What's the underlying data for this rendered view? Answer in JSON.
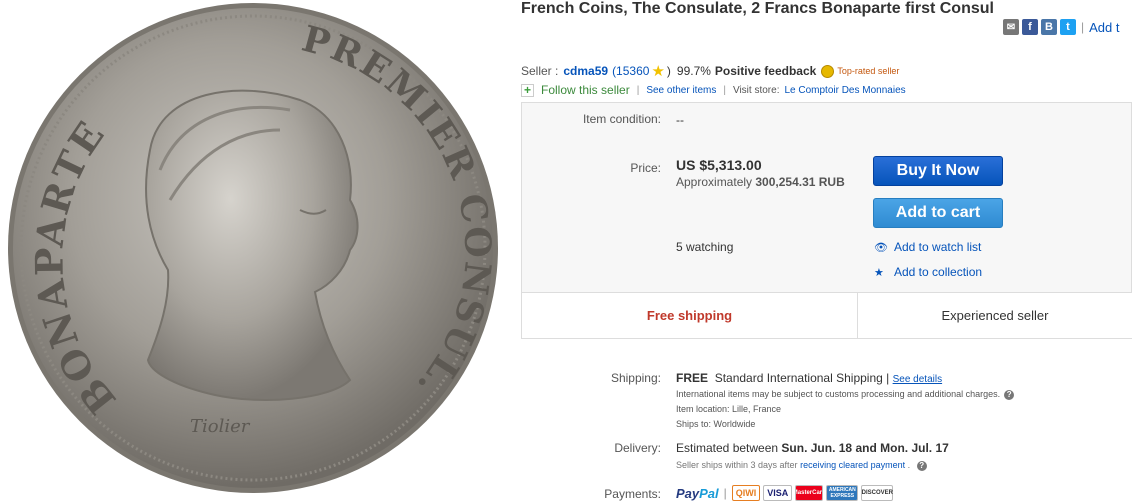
{
  "title": "French Coins, The Consulate, 2 Francs Bonaparte first Consul",
  "coin": {
    "left_text": "BONAPARTE",
    "right_text": "PREMIER CONSUL.",
    "signature": "Tiolier"
  },
  "share": {
    "icons": [
      "mail-icon",
      "facebook-icon",
      "vk-icon",
      "twitter-icon"
    ],
    "fb": "f",
    "vk": "B",
    "tw": "t",
    "separator": "|",
    "add_label": "Add t"
  },
  "seller": {
    "label": "Seller :",
    "name": "cdma59",
    "score_open": "(15360",
    "score_close": ")",
    "percent": "99.7%",
    "positive": "Positive feedback",
    "badge": "Top-rated seller",
    "follow": "Follow this seller",
    "see_other": "See other items",
    "visit_label": "Visit store:",
    "store": "Le Comptoir Des Monnaies"
  },
  "item": {
    "condition_label": "Item condition:",
    "condition_value": "--",
    "price_label": "Price:",
    "price": "US $5,313.00",
    "approx_label": "Approximately",
    "approx_value": "300,254.31 RUB",
    "buy_label": "Buy It Now",
    "cart_label": "Add to cart",
    "watching": "5 watching",
    "watch_list": "Add to watch list",
    "collection": "Add to collection",
    "free_shipping": "Free shipping",
    "experienced": "Experienced seller"
  },
  "shipping": {
    "label": "Shipping:",
    "free": "FREE",
    "method": "Standard International Shipping |",
    "see_details": "See details",
    "intl_note": "International items may be subject to customs processing and additional charges.",
    "location": "Item location:  Lille, France",
    "ships_to": "Ships to:  Worldwide"
  },
  "delivery": {
    "label": "Delivery:",
    "prefix": "Estimated between",
    "date1": "Sun. Jun. 18",
    "and": "and",
    "date2": "Mon. Jul. 17",
    "note_prefix": "Seller ships within 3 days after",
    "note_link": "receiving cleared payment",
    "note_suffix": "."
  },
  "payments": {
    "label": "Payments:",
    "paypal_a": "Pay",
    "paypal_b": "Pal",
    "separator": "|",
    "qiwi": "QIWI",
    "visa": "VISA",
    "mastercard": "MasterCard",
    "amex": "AMERICAN EXPRESS",
    "discover": "DISCOVER"
  },
  "colors": {
    "link": "#0654ba",
    "buy": "#0654ba",
    "cart": "#2f8bd2",
    "free_shipping": "#c0392b",
    "coin": "#9a968f"
  }
}
